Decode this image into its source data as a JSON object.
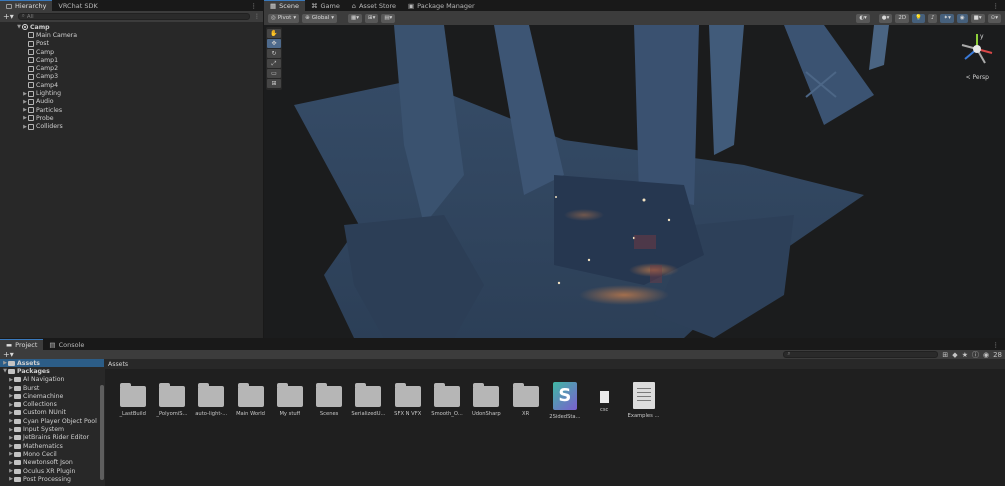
{
  "hierarchy": {
    "tabs": [
      "Hierarchy",
      "VRChat SDK"
    ],
    "search_placeholder": "All",
    "root": "Camp",
    "items": [
      {
        "label": "Main Camera",
        "expandable": false
      },
      {
        "label": "Post",
        "expandable": false
      },
      {
        "label": "Camp",
        "expandable": false
      },
      {
        "label": "Camp1",
        "expandable": false
      },
      {
        "label": "Camp2",
        "expandable": false
      },
      {
        "label": "Camp3",
        "expandable": false
      },
      {
        "label": "Camp4",
        "expandable": false
      },
      {
        "label": "Lighting",
        "expandable": true
      },
      {
        "label": "Audio",
        "expandable": true
      },
      {
        "label": "Particles",
        "expandable": true
      },
      {
        "label": "Probe",
        "expandable": true
      },
      {
        "label": "Colliders",
        "expandable": true
      }
    ]
  },
  "scene": {
    "tabs": [
      "Scene",
      "Game",
      "Asset Store",
      "Package Manager"
    ],
    "pivot": "Pivot",
    "global": "Global",
    "mode_2d": "2D",
    "persp": "< Persp",
    "gizmo_axis": "y"
  },
  "project": {
    "tabs": [
      "Project",
      "Console"
    ],
    "count_badge": "28",
    "tree": [
      {
        "label": "Assets",
        "level": 0,
        "selected": true
      },
      {
        "label": "Packages",
        "level": 0,
        "selected": false
      },
      {
        "label": "AI Navigation",
        "level": 1
      },
      {
        "label": "Burst",
        "level": 1
      },
      {
        "label": "Cinemachine",
        "level": 1
      },
      {
        "label": "Collections",
        "level": 1
      },
      {
        "label": "Custom NUnit",
        "level": 1
      },
      {
        "label": "Cyan Player Object Pool",
        "level": 1
      },
      {
        "label": "Input System",
        "level": 1
      },
      {
        "label": "JetBrains Rider Editor",
        "level": 1
      },
      {
        "label": "Mathematics",
        "level": 1
      },
      {
        "label": "Mono Cecil",
        "level": 1
      },
      {
        "label": "Newtonsoft Json",
        "level": 1
      },
      {
        "label": "Oculus XR Plugin",
        "level": 1
      },
      {
        "label": "Post Processing",
        "level": 1
      }
    ],
    "breadcrumb": "Assets",
    "assets": [
      {
        "label": "_LastBuild",
        "kind": "folder"
      },
      {
        "label": "_PolyomiS...",
        "kind": "folder"
      },
      {
        "label": "auto-light-...",
        "kind": "folder"
      },
      {
        "label": "Main World",
        "kind": "folder"
      },
      {
        "label": "My stuff",
        "kind": "folder"
      },
      {
        "label": "Scenes",
        "kind": "folder"
      },
      {
        "label": "SerializedU...",
        "kind": "folder"
      },
      {
        "label": "SFX N VFX",
        "kind": "folder"
      },
      {
        "label": "Smooth_O...",
        "kind": "folder"
      },
      {
        "label": "UdonSharp",
        "kind": "folder"
      },
      {
        "label": "XR",
        "kind": "folder"
      },
      {
        "label": "2SidedSta...",
        "kind": "shader",
        "glyph": "S"
      },
      {
        "label": "csc",
        "kind": "file"
      },
      {
        "label": "Examples ...",
        "kind": "doc"
      }
    ]
  }
}
